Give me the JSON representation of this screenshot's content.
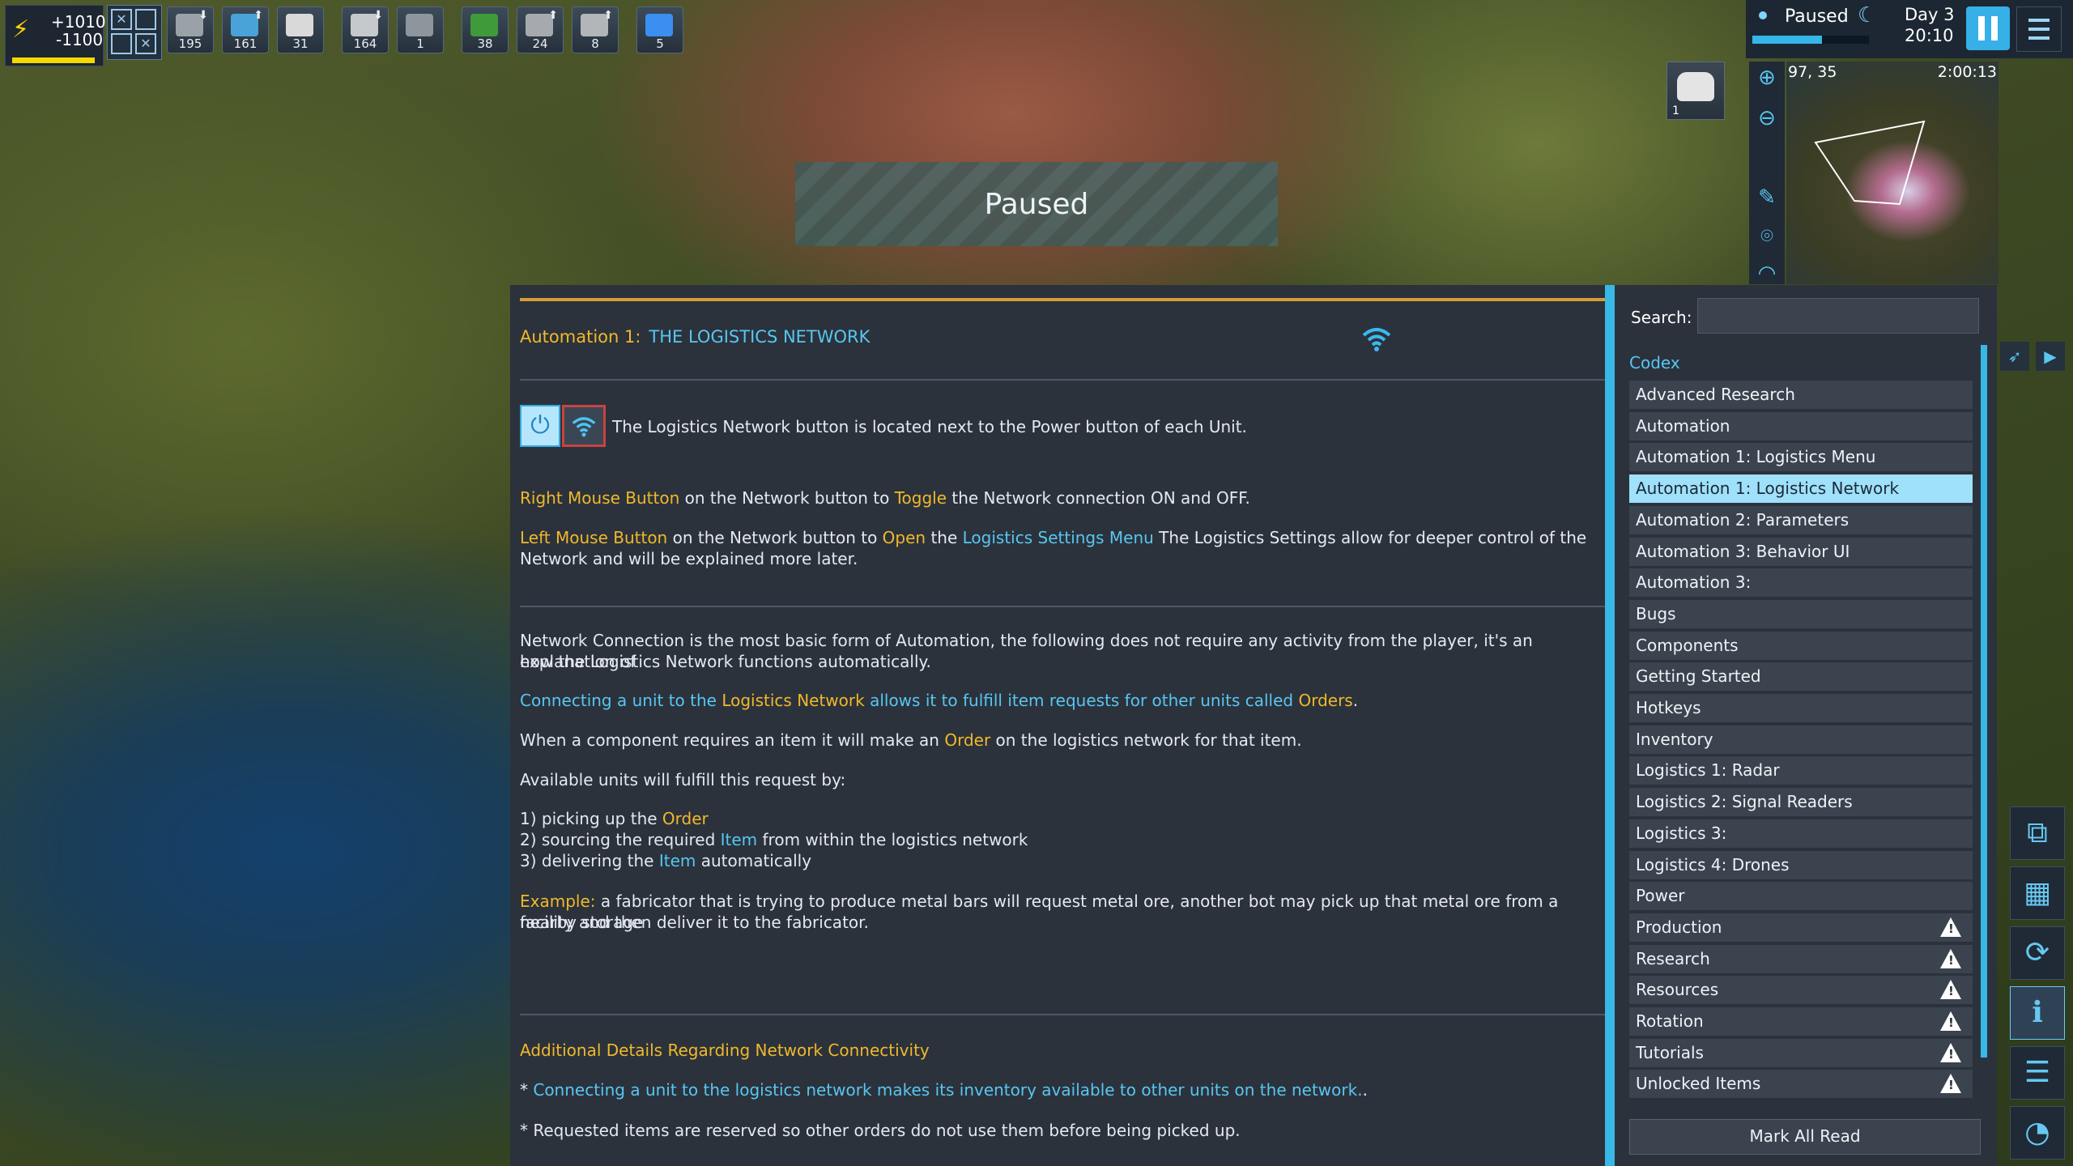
{
  "resources": {
    "power_plus": "+1010",
    "power_minus": "-1100",
    "power_level": 0.98,
    "accent_color": "#f5d800"
  },
  "hotbar": {
    "slots": [
      {
        "icon": "bot-unit-icon",
        "count": "195",
        "color": "#9aa2a8"
      },
      {
        "icon": "crystal-cluster-icon",
        "count": "161",
        "color": "#4aa3d8"
      },
      {
        "icon": "dome-icon",
        "count": "31",
        "color": "#d9d9d9"
      },
      {
        "icon": "building-icon",
        "count": "164",
        "color": "#c5c9cc"
      },
      {
        "icon": "plate-icon",
        "count": "1",
        "color": "#8e959c"
      },
      {
        "icon": "circuit-icon",
        "count": "38",
        "color": "#3f9a3a"
      },
      {
        "icon": "turret-icon",
        "count": "24",
        "color": "#a6aaae"
      },
      {
        "icon": "factory-icon",
        "count": "8",
        "color": "#b2b6b9"
      },
      {
        "icon": "blue-cube-icon",
        "count": "5",
        "color": "#3a8ff0"
      }
    ]
  },
  "banner": {
    "text": "Paused"
  },
  "status": {
    "state": "Paused",
    "day": "Day 3",
    "time": "20:10",
    "day_progress": 0.6
  },
  "minimap": {
    "coord": "97, 35",
    "clock": "2:00:13",
    "unit_count": "1"
  },
  "article": {
    "heading_prefix": "Automation 1:",
    "heading_title": "THE LOGISTICS NETWORK",
    "intro": "The Logistics Network button is located next to the Power button of each Unit.",
    "rmb": {
      "a": "Right Mouse Button",
      "b": " on the Network button to ",
      "c": "Toggle",
      "d": " the Network connection ON and OFF."
    },
    "lmb": {
      "a": "Left Mouse Button",
      "b": " on the Network button to ",
      "c": "Open",
      "d": " the ",
      "e": "Logistics Settings Menu",
      "f": "  The Logistics Settings allow for deeper control of the",
      "g": "Network and will be explained more later."
    },
    "p1a": "Network Connection is the most basic form of Automation, the following does not require any activity from the player, it's an explanation of",
    "p1b": "how the Logistics Network functions automatically.",
    "p2": {
      "a": "Connecting a unit to the ",
      "b": "Logistics Network",
      "c": " allows it to fulfill item requests for other units called ",
      "d": "Orders",
      "e": "."
    },
    "p3": {
      "a": "When a component requires an item it will make an ",
      "b": "Order",
      "c": " on the logistics network for that item."
    },
    "p4": "Available units will fulfill this request by:",
    "s1": {
      "a": "1) picking up the ",
      "b": "Order"
    },
    "s2": {
      "a": "2) sourcing the required ",
      "b": "Item",
      "c": " from within the logistics network"
    },
    "s3": {
      "a": "3) delivering the ",
      "b": "Item",
      "c": " automatically"
    },
    "ex": {
      "a": "Example:",
      "b": " a fabricator that is trying to produce metal bars will request metal ore, another bot may pick up that metal ore from a nearby storage",
      "c": "facility and then deliver it to the fabricator."
    },
    "additional": "Additional Details Regarding Network Connectivity",
    "d1": {
      "a": "* ",
      "b": "Connecting a unit to the logistics network makes its inventory available to other units on the network.",
      "c": "."
    },
    "d2": "* Requested items are reserved so other orders do not use them before being picked up."
  },
  "sidebar": {
    "search_label": "Search:",
    "search_value": "",
    "codex_label": "Codex",
    "items": [
      {
        "label": "Advanced Research",
        "warn": false
      },
      {
        "label": "Automation",
        "warn": false
      },
      {
        "label": "Automation 1:  Logistics Menu",
        "warn": false
      },
      {
        "label": "Automation 1:  Logistics Network",
        "warn": false,
        "selected": true
      },
      {
        "label": "Automation 2:  Parameters",
        "warn": false
      },
      {
        "label": "Automation 3:  Behavior UI",
        "warn": false
      },
      {
        "label": "Automation 3:",
        "warn": false
      },
      {
        "label": "Bugs",
        "warn": false
      },
      {
        "label": "Components",
        "warn": false
      },
      {
        "label": "Getting Started",
        "warn": false
      },
      {
        "label": "Hotkeys",
        "warn": false
      },
      {
        "label": "Inventory",
        "warn": false
      },
      {
        "label": "Logistics 1:  Radar",
        "warn": false
      },
      {
        "label": "Logistics 2:  Signal Readers",
        "warn": false
      },
      {
        "label": "Logistics 3:",
        "warn": false
      },
      {
        "label": "Logistics 4:  Drones",
        "warn": false
      },
      {
        "label": "Power",
        "warn": false
      },
      {
        "label": "Production",
        "warn": true
      },
      {
        "label": "Research",
        "warn": true
      },
      {
        "label": "Resources",
        "warn": true
      },
      {
        "label": "Rotation",
        "warn": true
      },
      {
        "label": "Tutorials",
        "warn": true
      },
      {
        "label": "Unlocked Items",
        "warn": true
      }
    ],
    "mark_all_read": "Mark All Read"
  }
}
